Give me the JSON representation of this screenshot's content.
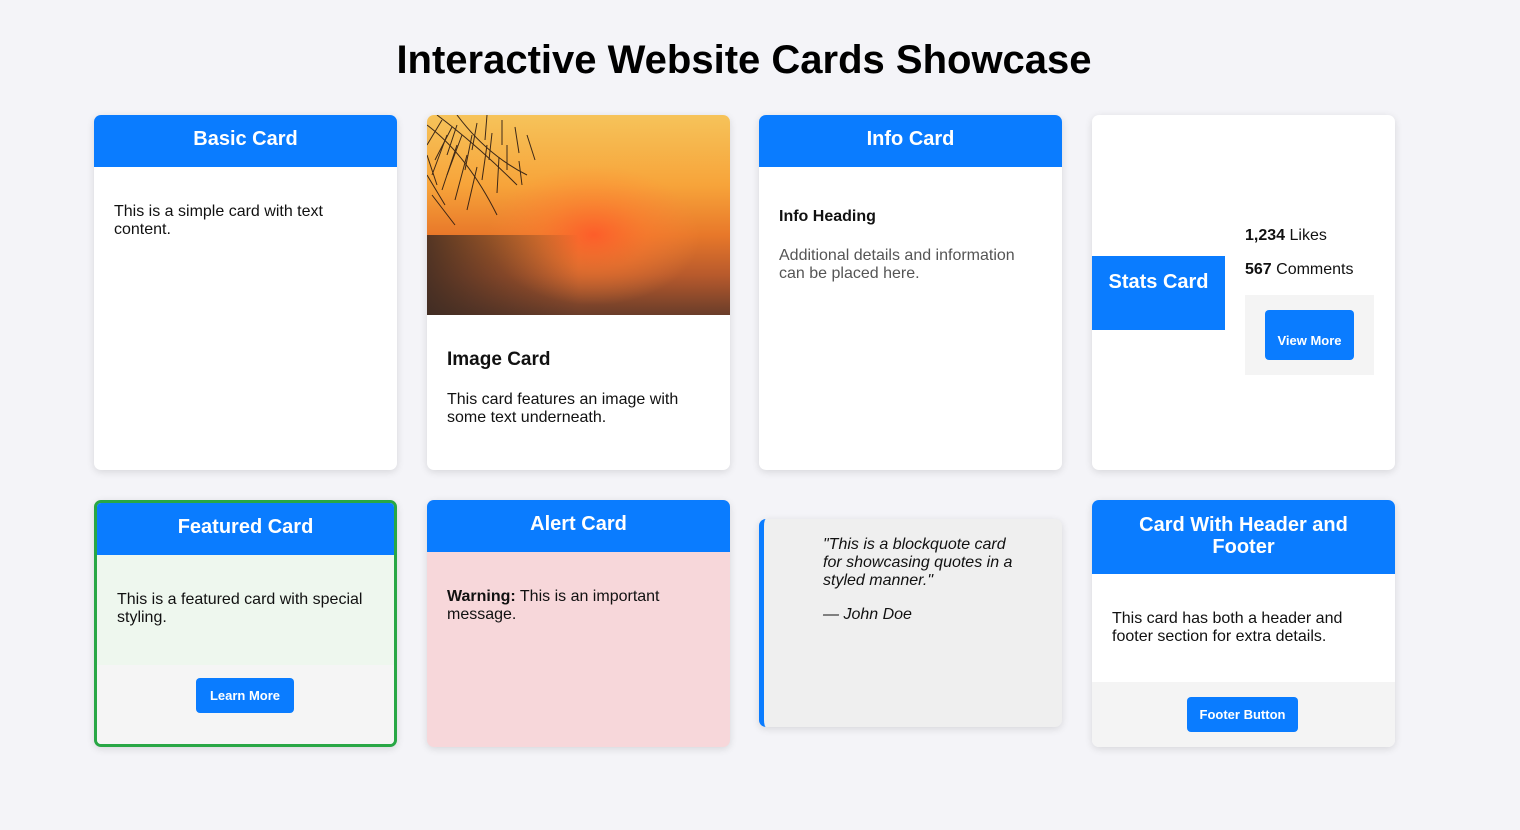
{
  "page": {
    "title": "Interactive Website Cards Showcase"
  },
  "basic_card": {
    "header": "Basic Card",
    "text": "This is a simple card with text content."
  },
  "image_card": {
    "image": "sunset-with-pine-branches-image",
    "title": "Image Card",
    "text": "This card features an image with some text underneath."
  },
  "info_card": {
    "header": "Info Card",
    "heading": "Info Heading",
    "text": "Additional details and information can be placed here."
  },
  "stats_card": {
    "header": "Stats Card",
    "likes_value": "1,234",
    "likes_label": " Likes",
    "comments_value": "567",
    "comments_label": " Comments",
    "button_label": "View More"
  },
  "featured_card": {
    "header": "Featured Card",
    "text": "This is a featured card with special styling.",
    "button_label": "Learn More"
  },
  "alert_card": {
    "header": "Alert Card",
    "warning_label": "Warning:",
    "text": " This is an important message."
  },
  "quote_card": {
    "quote": "\"This is a blockquote card for showcasing quotes in a styled manner.\"",
    "author": "— John Doe"
  },
  "header_footer_card": {
    "header": "Card With Header and Footer",
    "text": "This card has both a header and footer section for extra details.",
    "button_label": "Footer Button"
  },
  "colors": {
    "accent": "#0a7cff",
    "page_background": "#f4f4f8",
    "featured_border": "#28a745",
    "alert_background": "#f7d7da"
  }
}
